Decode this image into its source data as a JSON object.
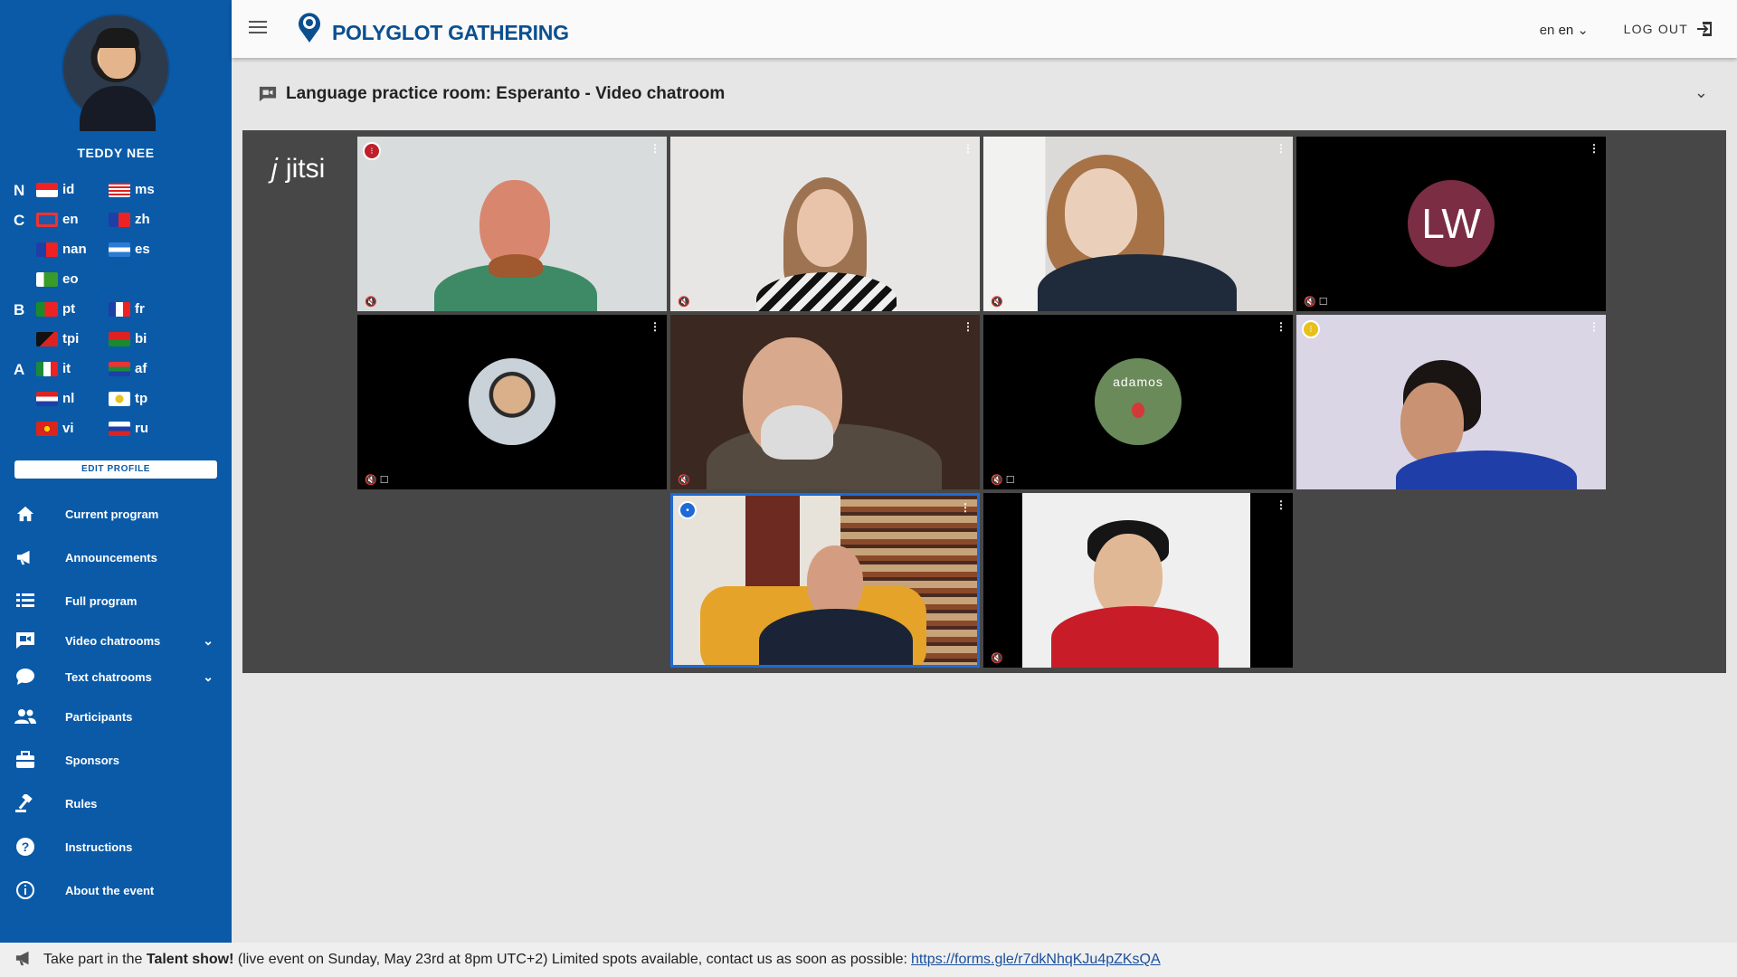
{
  "user": {
    "name": "TEDDY NEE"
  },
  "levels": [
    {
      "letter": "N"
    },
    {
      "letter": "C"
    },
    {
      "letter": "B"
    },
    {
      "letter": "A"
    }
  ],
  "languages": {
    "id": "id",
    "ms": "ms",
    "en": "en",
    "zh": "zh",
    "nan": "nan",
    "es": "es",
    "eo": "eo",
    "pt": "pt",
    "fr": "fr",
    "tpi": "tpi",
    "bi": "bi",
    "it": "it",
    "af": "af",
    "nl": "nl",
    "tp": "tp",
    "vi": "vi",
    "ru": "ru"
  },
  "sidebar": {
    "edit_profile": "EDIT PROFILE",
    "items": [
      {
        "label": "Current program",
        "icon": "home-icon"
      },
      {
        "label": "Announcements",
        "icon": "megaphone-icon"
      },
      {
        "label": "Full program",
        "icon": "list-icon"
      },
      {
        "label": "Video chatrooms",
        "icon": "video-chat-icon"
      },
      {
        "label": "Text chatrooms",
        "icon": "chat-bubble-icon"
      },
      {
        "label": "Participants",
        "icon": "people-icon"
      },
      {
        "label": "Sponsors",
        "icon": "briefcase-icon"
      },
      {
        "label": "Rules",
        "icon": "gavel-icon"
      },
      {
        "label": "Instructions",
        "icon": "help-icon"
      },
      {
        "label": "About the event",
        "icon": "info-icon"
      }
    ]
  },
  "header": {
    "brand": "POLYGLOT GATHERING",
    "lang_current_a": "en",
    "lang_current_b": "en",
    "logout": "LOG OUT"
  },
  "room": {
    "title": "Language practice room: Esperanto - Video chatroom"
  },
  "jitsi": {
    "logo_text": "jitsi"
  },
  "tiles": [
    {
      "initials": "LW"
    },
    {
      "overlay_text": "adamos"
    }
  ],
  "announcement": {
    "prefix": "Take part in the",
    "bold": "Talent show!",
    "body": "(live event on Sunday, May 23rd at 8pm UTC+2) Limited spots available, contact us as soon as possible:",
    "link": "https://forms.gle/r7dkNhqKJu4pZKsQA"
  },
  "colors": {
    "sidebar": "#0a5aa8",
    "brand": "#0b4f8f",
    "video_bg": "#474747",
    "active_border": "#1f6ad6"
  }
}
